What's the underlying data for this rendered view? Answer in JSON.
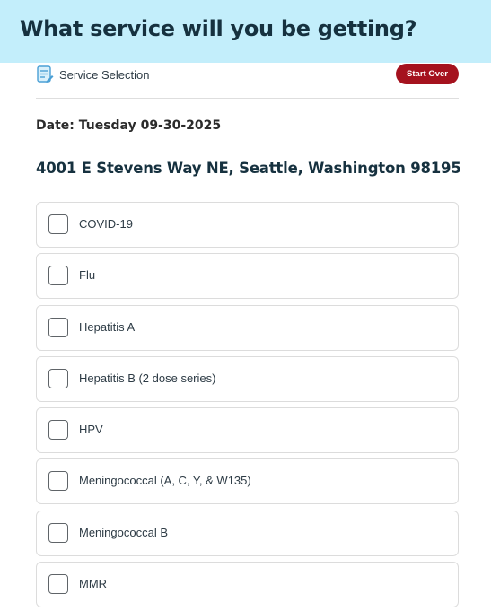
{
  "header": {
    "title": "What service will you be getting?"
  },
  "toolbar": {
    "icon": "document-list-icon",
    "label": "Service Selection",
    "start_over_label": "Start Over"
  },
  "appointment": {
    "date": "Date: Tuesday 09-30-2025",
    "address": "4001 E Stevens Way NE, Seattle, Washington 98195"
  },
  "services": [
    {
      "label": "COVID-19",
      "checked": false
    },
    {
      "label": "Flu",
      "checked": false
    },
    {
      "label": "Hepatitis A",
      "checked": false
    },
    {
      "label": "Hepatitis B (2 dose series)",
      "checked": false
    },
    {
      "label": "HPV",
      "checked": false
    },
    {
      "label": "Meningococcal (A, C, Y, & W135)",
      "checked": false
    },
    {
      "label": "Meningococcal B",
      "checked": false
    },
    {
      "label": "MMR",
      "checked": false
    }
  ],
  "colors": {
    "banner_bg": "#c3eefb",
    "accent_button": "#a5121e",
    "title_text": "#16313f"
  }
}
